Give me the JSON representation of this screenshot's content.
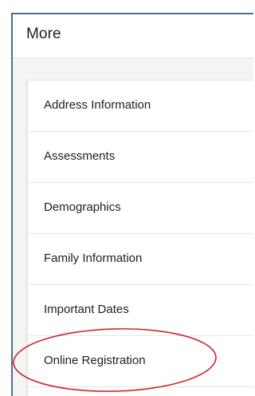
{
  "header": {
    "title": "More"
  },
  "menu": {
    "items": [
      {
        "label": "Address Information"
      },
      {
        "label": "Assessments"
      },
      {
        "label": "Demographics"
      },
      {
        "label": "Family Information"
      },
      {
        "label": "Important Dates"
      },
      {
        "label": "Online Registration"
      }
    ]
  },
  "annotation": {
    "color": "#d0262e"
  }
}
